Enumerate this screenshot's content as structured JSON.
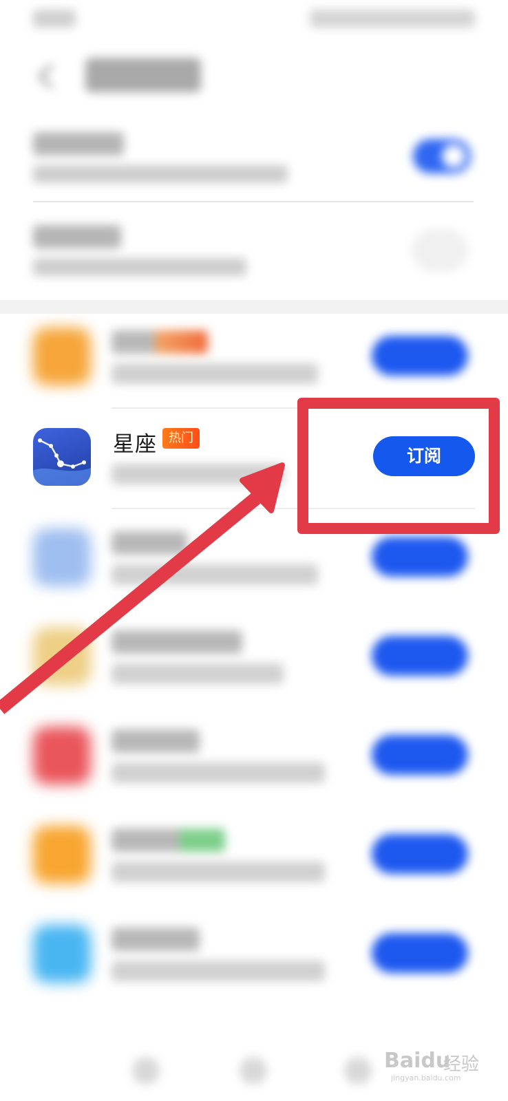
{
  "featured": {
    "name": "星座",
    "badge": "热门",
    "button": "订阅"
  },
  "watermark": {
    "brand": "Baidu",
    "brand_cn": "经验",
    "domain": "jingyan.baidu.com"
  },
  "colors": {
    "accent": "#1558ee",
    "highlight": "#e23a46",
    "badge": "#ff5a1a"
  },
  "icons": {
    "back": "back-arrow-icon",
    "chevron": "chevron-right-icon",
    "featured_app": "constellation-icon"
  }
}
